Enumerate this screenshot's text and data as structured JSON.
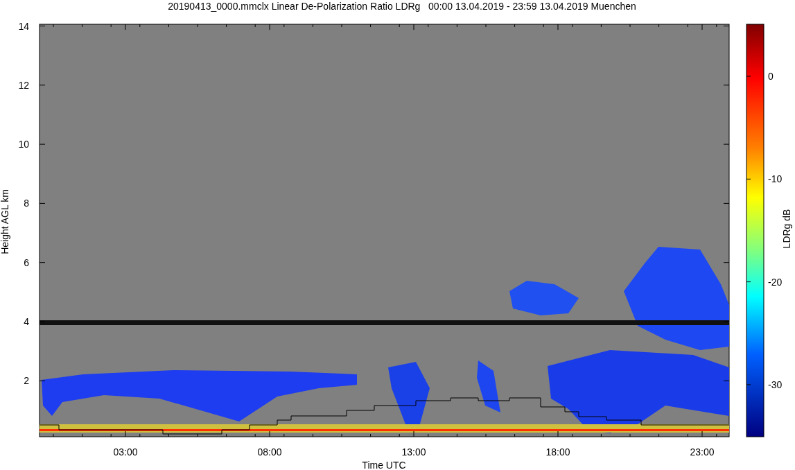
{
  "title": "20190413_0000.mmclx Linear De-Polarization Ratio LDRg   00:00 13.04.2019 - 23:59 13.04.2019 Muenchen",
  "y_axis": {
    "label": "Height AGL km",
    "ticks": [
      "14",
      "12",
      "10",
      "8",
      "6",
      "4",
      "2"
    ]
  },
  "x_axis": {
    "label": "Time UTC",
    "ticks": [
      "03:00",
      "08:00",
      "13:00",
      "18:00",
      "23:00"
    ]
  },
  "colorbar": {
    "label": "LDRg dB",
    "ticks": [
      "0",
      "-10",
      "-20",
      "-30"
    ]
  }
}
